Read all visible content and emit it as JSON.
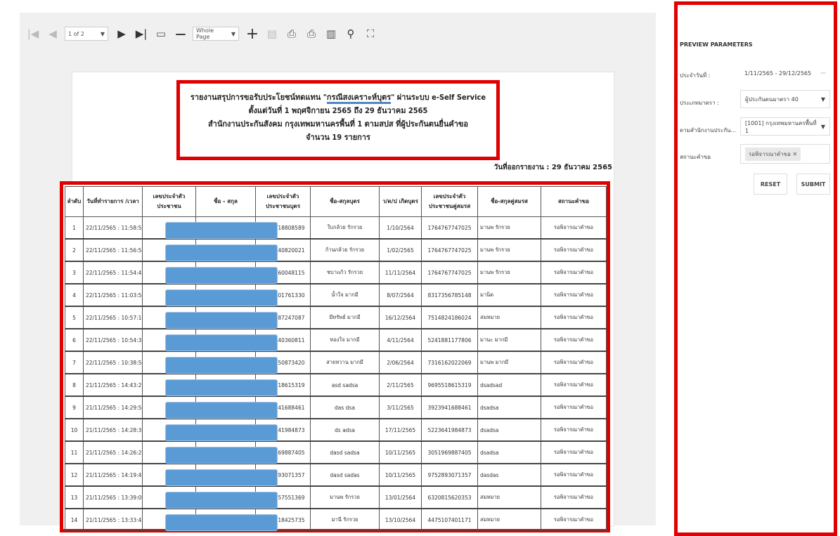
{
  "toolbar": {
    "page_select": "1 of 2",
    "zoom_select": "Whole Page",
    "icons": [
      "first-page-icon",
      "prev-page-icon",
      "next-page-icon",
      "last-page-icon",
      "multipage-icon",
      "zoom-out-icon",
      "zoom-in-icon",
      "highlight-icon",
      "print-icon",
      "print-page-icon",
      "export-icon",
      "search-icon",
      "fullscreen-icon"
    ]
  },
  "report": {
    "title_line1_before": "รายงานสรุปการขอรับประโยชน์ทดแทน \"",
    "title_line1_highlight": "กรณีสงเคราะห์บุตร",
    "title_line1_after": "\" ผ่านระบบ e-Self Service",
    "title_line2": "ตั้งแต่วันที่ 1 พฤศจิกายน 2565 ถึง 29 ธันวาคม 2565",
    "title_line3": "สำนักงานประกันสังคม กรุงเทพมหานครพื้นที่ 1 ตามสปส ที่ผู้ประกันตนยื่นคำขอ",
    "title_line4": "จำนวน 19 รายการ",
    "issued_date": "วันที่ออกรายงาน : 29 ธันวาคม 2565",
    "columns": [
      "ลำดับ",
      "วันที่ทำรายการ /เวลา",
      "เลขประจำตัวประชาชน",
      "ชื่อ - สกุล",
      "เลขประจำตัว ประชาชนบุตร",
      "ชื่อ-สกุลบุตร",
      "ว/ด/ป เกิดบุตร",
      "เลขประจำตัว ประชาชนคู่สมรส",
      "ชื่อ-สกุลคู่สมรส",
      "สถานะคำขอ"
    ],
    "rows": [
      [
        "1",
        "22/11/2565 : 11:58:53",
        "5107618808589",
        "ใบกล้วย รักรวย",
        "1/10/2564",
        "1764767747025",
        "มานพ รักรวย",
        "รอพิจารณาคำขอ"
      ],
      [
        "2",
        "22/11/2565 : 11:56:52",
        "1054840820021",
        "ก้านกล้วย รักรวย",
        "1/02/2565",
        "1764767747025",
        "มานพ รักรวย",
        "รอพิจารณาคำขอ"
      ],
      [
        "3",
        "22/11/2565 : 11:54:41",
        "5158760048115",
        "ชบาแก้ว รักรวย",
        "11/11/2564",
        "1764767747025",
        "มานพ รักรวย",
        "รอพิจารณาคำขอ"
      ],
      [
        "4",
        "22/11/2565 : 11:03:54",
        "6211001761330",
        "น้ำใจ มากมี",
        "8/07/2564",
        "8317356785148",
        "มานิด",
        "รอพิจารณาคำขอ"
      ],
      [
        "5",
        "22/11/2565 : 10:57:16",
        "3002187247087",
        "มีทรัพย์ มากมี",
        "16/12/2564",
        "7514824186024",
        "สมหมาย",
        "รอพิจารณาคำขอ"
      ],
      [
        "6",
        "22/11/2565 : 10:54:36",
        "4225140360811",
        "ทองใจ มากมี",
        "4/11/2564",
        "5241881177806",
        "มานะ มากมี",
        "รอพิจารณาคำขอ"
      ],
      [
        "7",
        "22/11/2565 : 10:38:54",
        "8551850873420",
        "สายหวาน มากมี",
        "2/06/2564",
        "7316162022069",
        "มานพ มากมี",
        "รอพิจารณาคำขอ"
      ],
      [
        "8",
        "21/11/2565 : 14:43:29",
        "9695518615319",
        "asd sadsa",
        "2/11/2565",
        "9695518615319",
        "dsadsad",
        "รอพิจารณาคำขอ"
      ],
      [
        "9",
        "21/11/2565 : 14:29:54",
        "3923941688461",
        "das dsa",
        "3/11/2565",
        "3923941688461",
        "dsadsa",
        "รอพิจารณาคำขอ"
      ],
      [
        "10",
        "21/11/2565 : 14:28:37",
        "5223641984873",
        "ds adsa",
        "17/11/2565",
        "5223641984873",
        "dsadsa",
        "รอพิจารณาคำขอ"
      ],
      [
        "11",
        "21/11/2565 : 14:26:29",
        "3051969887405",
        "dasd sadsa",
        "10/11/2565",
        "3051969887405",
        "dsadsa",
        "รอพิจารณาคำขอ"
      ],
      [
        "12",
        "21/11/2565 : 14:19:42",
        "9752893071357",
        "dasd sadas",
        "10/11/2565",
        "9752893071357",
        "dasdas",
        "รอพิจารณาคำขอ"
      ],
      [
        "13",
        "21/11/2565 : 13:39:09",
        "1886357551369",
        "มานพ รักรวย",
        "13/01/2564",
        "6320815620353",
        "สมหมาย",
        "รอพิจารณาคำขอ"
      ],
      [
        "14",
        "21/11/2565 : 13:33:42",
        "1241118425735",
        "มานี รักรวย",
        "13/10/2564",
        "4475107401171",
        "สมหมาย",
        "รอพิจารณาคำขอ"
      ]
    ]
  },
  "params": {
    "title": "PREVIEW PARAMETERS",
    "date_label": "ประจำวันที่ :",
    "date_value": "1/11/2565 - 29/12/2565",
    "type_label": "ประเภทมาตรา :",
    "type_value": "ผู้ประกันตนมาตรา 40",
    "office_label": "ตามสำนักงานประกัน...",
    "office_value": "[1001] กรุงเทพมหานครพื้นที่ 1",
    "status_label": "สถานะคำขอ",
    "status_chip": "รอพิจารณาคำขอ",
    "reset_label": "RESET",
    "submit_label": "SUBMIT"
  },
  "colors": {
    "highlight_border": "#e00000",
    "redaction": "#5b9bd5",
    "underline": "#4f86c6"
  }
}
